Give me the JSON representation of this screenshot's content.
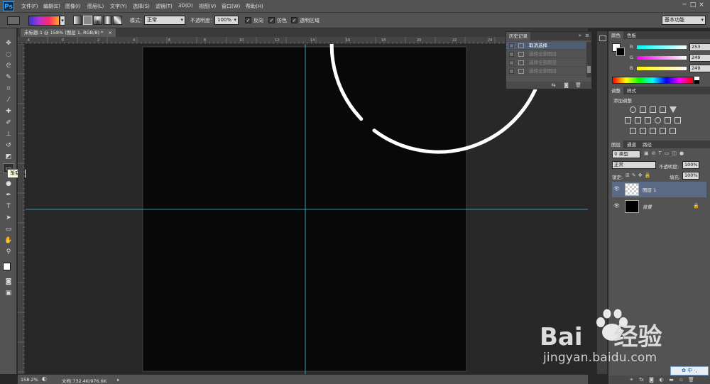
{
  "app": {
    "logo": "Ps",
    "theme_dark": "#535353",
    "canvas_color": "#080808",
    "guide_color": "#3fc1d0"
  },
  "menu": [
    "文件(F)",
    "编辑(E)",
    "图像(I)",
    "图层(L)",
    "文字(Y)",
    "选择(S)",
    "滤镜(T)",
    "3D(D)",
    "视图(V)",
    "窗口(W)",
    "帮助(H)"
  ],
  "window_controls": [
    "─",
    "□",
    "×"
  ],
  "options": {
    "mode_label": "模式：",
    "mode_value": "正常",
    "opacity_label": "不透明度：",
    "opacity_value": "100%",
    "reverse_label": "反向",
    "dither_label": "仿色",
    "transparency_label": "透明区域",
    "workspace_value": "基本功能"
  },
  "tooltip": "渐变工具 (G)",
  "document": {
    "tab_title": "未标题-1 @ 158% (图层 1, RGB/8) *",
    "close": "×"
  },
  "ruler_top": [
    "-4",
    "0",
    "2",
    "4",
    "6",
    "8",
    "10",
    "12",
    "14",
    "16",
    "18",
    "20",
    "22",
    "24",
    "26",
    "28"
  ],
  "status": {
    "zoom": "158.2%",
    "doc_info": "文档:732.4K/976.6K"
  },
  "history": {
    "tab": "历史记录",
    "items": [
      {
        "label": "取消选择",
        "active": true
      },
      {
        "label": "选择全部图层",
        "active": false
      },
      {
        "label": "选择全部图层",
        "active": false
      },
      {
        "label": "选择全部图层",
        "active": false
      }
    ]
  },
  "color_panel": {
    "tabs": [
      "颜色",
      "色板"
    ],
    "r_label": "R",
    "r_value": "253",
    "g_label": "G",
    "g_value": "249",
    "b_label": "B",
    "b_value": "249"
  },
  "adjust_panel": {
    "tabs": [
      "调整",
      "样式"
    ],
    "title": "添加调整"
  },
  "layers_panel": {
    "tabs": [
      "图层",
      "通道",
      "路径"
    ],
    "filter_value": "类型",
    "blend_value": "正常",
    "opacity_label": "不透明度:",
    "opacity_value": "100%",
    "lock_label": "锁定:",
    "fill_label": "填充:",
    "fill_value": "100%",
    "layers": [
      {
        "name": "图层 1",
        "selected": true
      },
      {
        "name": "背景",
        "selected": false
      }
    ],
    "footer_icons": [
      "link-icon",
      "fx-icon",
      "mask-icon",
      "adjustment-icon",
      "folder-icon",
      "new-layer-icon",
      "trash-icon"
    ]
  },
  "watermark": {
    "brand": "Bai",
    "brand_cn": "经验",
    "url": "jingyan.baidu.com"
  },
  "ime": "中"
}
